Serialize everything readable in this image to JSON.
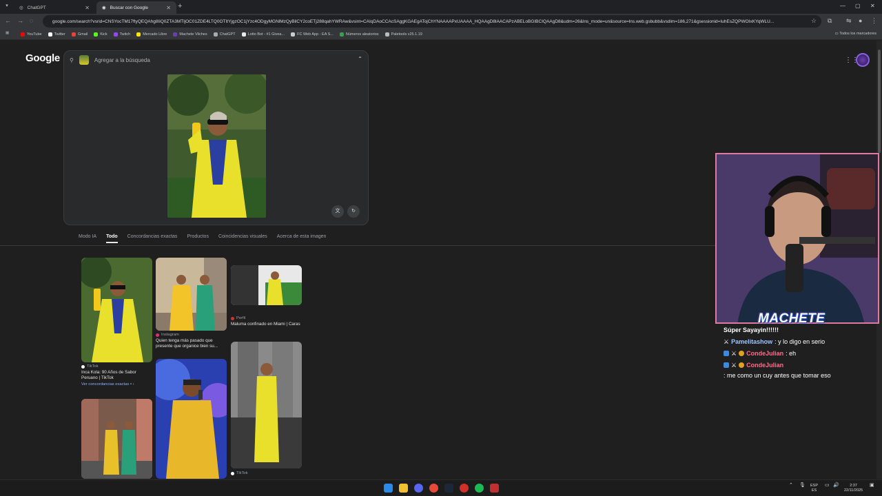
{
  "browser": {
    "tabs": [
      {
        "label": "ChatGPT"
      },
      {
        "label": "Buscar con Google"
      }
    ],
    "url": "google.com/search?vsrid=CNSYocTM17ftyQEQAhg8IiQ0ZTA3MTljOC01ZDE4LTQ0OTItYjgzOC1jYzc4ODgyMGNlMzQyBilCY2coETj288qahYWRAw&vsint=CAIqDAoCCAcSAggKGAEgATojChYNAAAAPxUAAAA_HQAAgD8lAACAPzABELoBGIBCIQAAgD8&udm=26&lns_mode=un&source=lns.web.gsbubb&vsdim=186,271&gsessionid=IuhEsZQPWOIxKYqWLU...",
    "bookmarks": [
      {
        "label": "YouTube",
        "color": "#ff0000"
      },
      {
        "label": "Twitter",
        "color": "#ffffff"
      },
      {
        "label": "Gmail",
        "color": "#ea4335"
      },
      {
        "label": "Kick",
        "color": "#53fc18"
      },
      {
        "label": "Twitch",
        "color": "#9146ff"
      },
      {
        "label": "Mercado Libre",
        "color": "#ffe600"
      },
      {
        "label": "Machete Vilches",
        "color": "#6a3fb0"
      },
      {
        "label": "ChatGPT",
        "color": "#aaaaaa"
      },
      {
        "label": "Lotto Bot - #1 Givea...",
        "color": "#e8e8e8"
      },
      {
        "label": "FC Web App - EA S...",
        "color": "#cccccc"
      },
      {
        "label": "Números aleatorios",
        "color": "#3ca04a"
      },
      {
        "label": "Paletools v25.1.19",
        "color": "#bbbbbb"
      }
    ],
    "all_bookmarks": "Todos los marcadores"
  },
  "google": {
    "logo": "Google",
    "search_placeholder": "Agregar a la búsqueda",
    "filter_tabs": [
      {
        "label": "Modo IA"
      },
      {
        "label": "Todo"
      },
      {
        "label": "Concordancias exactas"
      },
      {
        "label": "Productos"
      },
      {
        "label": "Coincidencias visuales"
      },
      {
        "label": "Acerca de esta imagen"
      }
    ],
    "results": [
      {
        "source": "TikTok",
        "title": "Inca Kola: 90 Años de Sabor Peruano | TikTok",
        "link": "Ver concordancias exactas",
        "source_color": "#ffffff"
      },
      {
        "source": "Instagram",
        "title": "Quien tenga más pasado que presente que organice bien su...",
        "source_color": "#e1306c"
      },
      {
        "source": "Perfil",
        "title": "Maluma confinado en Miami | Caras",
        "source_color": "#d93025"
      },
      {
        "source": "TikTok",
        "title": "",
        "source_color": "#ffffff"
      }
    ]
  },
  "stream": {
    "overlay_name": "MACHETE",
    "chat": [
      {
        "user": "",
        "message": "Súper Sayayin!!!!!!",
        "color": "#ffffff"
      },
      {
        "user": "Pamelitashow",
        "message": ": y lo digo en serio",
        "color": "#9ec3ff"
      },
      {
        "user": "CondeJulian",
        "message": ": eh",
        "color": "#ff6b8a"
      },
      {
        "user": "CondeJulian",
        "message": ": me como un cuy antes que tomar eso",
        "color": "#ff6b8a"
      }
    ]
  },
  "taskbar": {
    "lang": "ESP",
    "lang_sub": "ES",
    "time": "2:37",
    "date": "22/11/2025"
  }
}
